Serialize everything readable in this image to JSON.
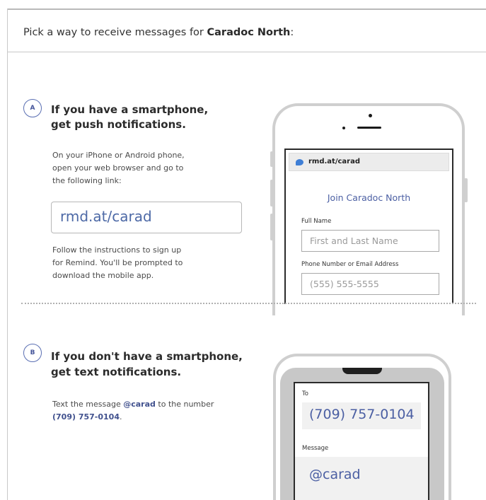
{
  "header": {
    "prefix": "Pick a way to receive messages for ",
    "class_name": "Caradoc North",
    "suffix": ":"
  },
  "section_a": {
    "badge": "A",
    "title_line1": "If you have a smartphone,",
    "title_line2": "get push notifications.",
    "instructions": [
      "On your iPhone or Android phone,",
      "open your web browser and go to",
      "the following link:"
    ],
    "link": "rmd.at/carad",
    "follow_up": [
      "Follow the instructions to sign up",
      "for Remind. You'll be prompted to",
      "download the mobile app."
    ],
    "phone": {
      "url": "rmd.at/carad",
      "join_title": "Join Caradoc North",
      "full_name_label": "Full Name",
      "full_name_placeholder": "First and Last Name",
      "contact_label": "Phone Number or Email Address",
      "contact_placeholder": "(555) 555-5555"
    }
  },
  "section_b": {
    "badge": "B",
    "title_line1_pre": "If you ",
    "title_line1_strong": "don't",
    "title_line1_post": " have a smartphone,",
    "title_line2": "get text notifications.",
    "text_pre": "Text the message ",
    "text_code": "@carad",
    "text_mid": " to the number",
    "text_number": "(709) 757-0104",
    "text_end": ".",
    "phone": {
      "to_label": "To",
      "number": "(709) 757-0104",
      "message_label": "Message",
      "message": "@carad"
    }
  },
  "colors": {
    "accent": "#4b5fa3",
    "border": "#b7b7b7"
  }
}
